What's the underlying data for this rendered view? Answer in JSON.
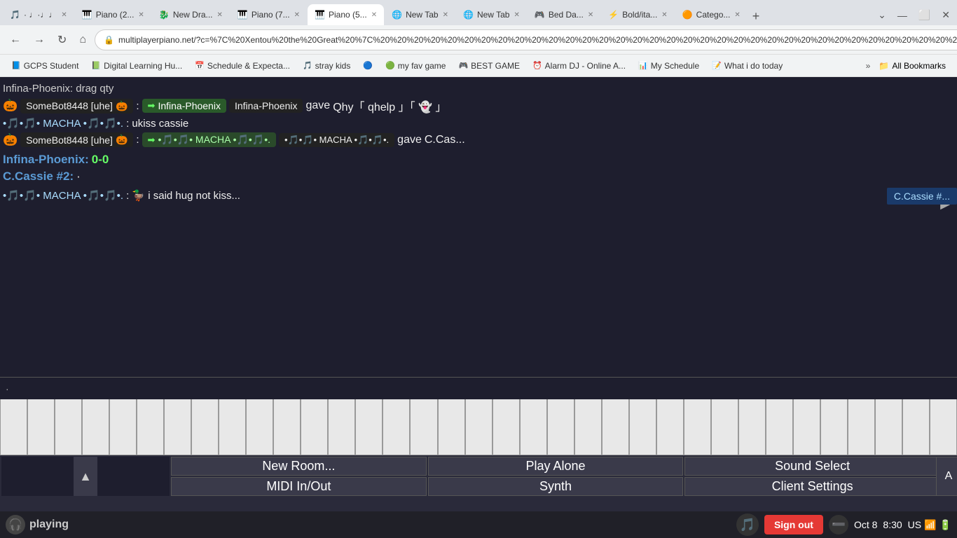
{
  "browser": {
    "tabs": [
      {
        "id": 1,
        "favicon": "🎵",
        "title": "· ♩·♩♩",
        "active": false
      },
      {
        "id": 2,
        "favicon": "🎹",
        "title": "Piano (2...",
        "active": false
      },
      {
        "id": 3,
        "favicon": "🐉",
        "title": "New Dra...",
        "active": false
      },
      {
        "id": 4,
        "favicon": "🎹",
        "title": "Piano (7...",
        "active": false
      },
      {
        "id": 5,
        "favicon": "🎹",
        "title": "Piano (5...",
        "active": true
      },
      {
        "id": 6,
        "favicon": "🌐",
        "title": "New Tab",
        "active": false
      },
      {
        "id": 7,
        "favicon": "🌐",
        "title": "New Tab",
        "active": false
      },
      {
        "id": 8,
        "favicon": "🎮",
        "title": "Bed Da...",
        "active": false
      },
      {
        "id": 9,
        "favicon": "⚡",
        "title": "Bold/ita...",
        "active": false
      },
      {
        "id": 10,
        "favicon": "🟠",
        "title": "Catego...",
        "active": false
      }
    ],
    "url": "multiplayerpiano.net/?c=%7C%20Xentou%20the%20Great%20%7C%20%20%20%20%20%20%20%20%20%20%20%20%20%20%20%20%20%20%20%20%20%20%20%20%20%20%20%20%20%20%20%20%20%20%20%20%20%20%20%20%20%20%20%20%20",
    "bookmarks": [
      {
        "favicon": "📘",
        "label": "GCPS Student"
      },
      {
        "favicon": "📗",
        "label": "Digital Learning Hu..."
      },
      {
        "favicon": "📅",
        "label": "Schedule & Expecta..."
      },
      {
        "favicon": "🎵",
        "label": "stray kids"
      },
      {
        "favicon": "🔵",
        "label": ""
      },
      {
        "favicon": "🟢",
        "label": "my fav game"
      },
      {
        "favicon": "🎮",
        "label": "BEST GAME"
      },
      {
        "favicon": "⏰",
        "label": "Alarm DJ - Online A..."
      },
      {
        "favicon": "📊",
        "label": "My Schedule"
      },
      {
        "favicon": "📝",
        "label": "What i do today"
      },
      {
        "favicon": "📁",
        "label": "All Bookmarks"
      }
    ]
  },
  "chat": {
    "messages": [
      {
        "type": "system_scroll",
        "text": "Infina-Phoenix: drag qty"
      },
      {
        "type": "bot_msg",
        "sender_emoji": "🎃",
        "sender": "SomeBot8448 [uhe]",
        "sender_emoji2": "🎃",
        "action_tag": "Infina-Phoenix",
        "text1": "Infina-Phoenix",
        "text2": "gave",
        "text3": "Qhy",
        "text4": "「 qhelp 」「 👻 」"
      },
      {
        "type": "music_msg",
        "prefix": "•🎵•🎵• MACHA •🎵•🎵•.",
        "text": ": ukiss cassie"
      },
      {
        "type": "bot_msg2",
        "sender_emoji": "🎃",
        "sender": "SomeBot8448 [uhe]",
        "sender_emoji2": "🎃",
        "action_tag": "•🎵•🎵• MACHA •🎵•🎵•.",
        "gave_tag": "•🎵•🎵• MACHA •🎵•🎵•.",
        "text2": "gave",
        "text3": "C.Cas..."
      },
      {
        "type": "status",
        "name": "Infina-Phoenix:",
        "value": "0-0"
      },
      {
        "type": "status",
        "name": "C.Cassie #2:",
        "value": "·"
      },
      {
        "type": "music_msg2",
        "prefix": "•🎵•🎵• MACHA •🎵•🎵•.",
        "text": ": 🦆 i said hug not kiss..."
      }
    ],
    "cursor_indicator": "▶",
    "player_tag": "C.Cassie #..."
  },
  "controls": {
    "volume_btn": "▲",
    "new_room_label": "New Room...",
    "play_alone_label": "Play Alone",
    "sound_select_label": "Sound Select",
    "midi_label": "MIDI In/Out",
    "synth_label": "Synth",
    "client_settings_label": "Client Settings",
    "extra_btn": "A"
  },
  "status_bar": {
    "now_playing_label": "playing",
    "signout_label": "Sign out",
    "date": "Oct 8",
    "time": "8:30",
    "region": "US",
    "wifi_icon": "📶",
    "battery_icon": "🔋"
  }
}
